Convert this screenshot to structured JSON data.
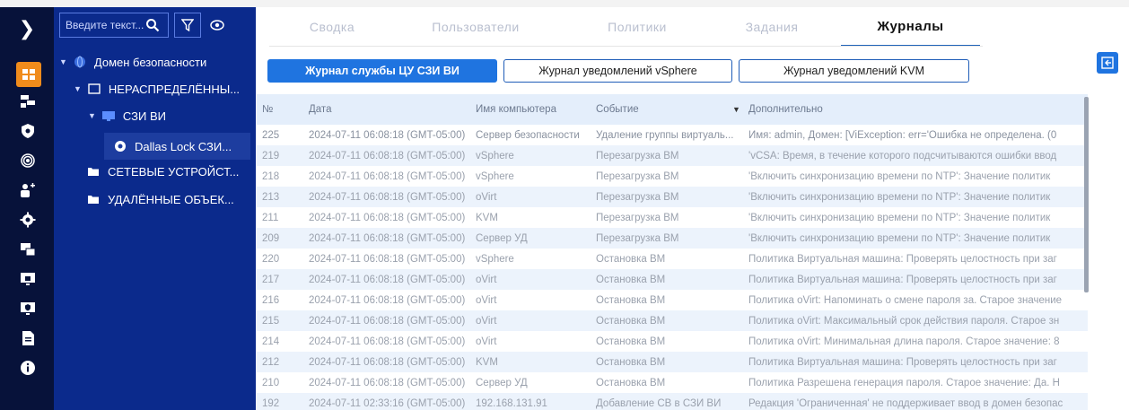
{
  "rail": {
    "toggle_glyph": "❯",
    "icons": [
      "grid-icon",
      "servers-icon",
      "shield-icon",
      "fingerprint-icon",
      "users-add-icon",
      "gear-icon",
      "devices-icon",
      "monitor-lock-icon",
      "monitor-shield-icon",
      "document-icon",
      "info-icon"
    ],
    "active_icon": "grid-icon",
    "accent_color": "#f08c1c"
  },
  "tree": {
    "search_placeholder": "Введите текст...",
    "nodes": [
      {
        "label": "Домен безопасности",
        "level": 0
      },
      {
        "label": "НЕРАСПРЕДЕЛЁННЫ...",
        "level": 1
      },
      {
        "label": "СЗИ ВИ",
        "level": 2
      },
      {
        "label": "Dallas Lock СЗИ...",
        "level": 3
      },
      {
        "label": "СЕТЕВЫЕ УСТРОЙСТ...",
        "level": 1
      },
      {
        "label": "УДАЛЁННЫЕ ОБЪЕК...",
        "level": 1
      }
    ]
  },
  "tabs": [
    {
      "label": "Сводка"
    },
    {
      "label": "Пользователи"
    },
    {
      "label": "Политики"
    },
    {
      "label": "Задания"
    },
    {
      "label": "Журналы",
      "active": true
    }
  ],
  "subtabs": [
    {
      "label": "Журнал службы ЦУ СЗИ ВИ",
      "active": true
    },
    {
      "label": "Журнал уведомлений vSphere"
    },
    {
      "label": "Журнал уведомлений KVM"
    }
  ],
  "table": {
    "columns": [
      "№",
      "Дата",
      "Имя компьютера",
      "Событие",
      "Дополнительно"
    ],
    "sorted_column": "Событие",
    "rows": [
      {
        "num": "225",
        "date": "2024-07-11 06:08:18 (GMT-05:00)",
        "computer": "Сервер безопасности",
        "event": "Удаление группы виртуаль...",
        "extra": "Имя: admin, Домен: [ViException: err='Ошибка не определена. (0"
      },
      {
        "num": "219",
        "date": "2024-07-11 06:08:18 (GMT-05:00)",
        "computer": "vSphere",
        "event": "Перезагрузка ВМ",
        "extra": "'vCSA: Время, в течение которого подсчитываются ошибки ввод"
      },
      {
        "num": "218",
        "date": "2024-07-11 06:08:18 (GMT-05:00)",
        "computer": "vSphere",
        "event": "Перезагрузка ВМ",
        "extra": "'Включить синхронизацию времени по NTP': Значение политик"
      },
      {
        "num": "213",
        "date": "2024-07-11 06:08:18 (GMT-05:00)",
        "computer": "oVirt",
        "event": "Перезагрузка ВМ",
        "extra": "'Включить синхронизацию времени по NTP': Значение политик"
      },
      {
        "num": "211",
        "date": "2024-07-11 06:08:18 (GMT-05:00)",
        "computer": "KVM",
        "event": "Перезагрузка ВМ",
        "extra": "'Включить синхронизацию времени по NTP': Значение политик"
      },
      {
        "num": "209",
        "date": "2024-07-11 06:08:18 (GMT-05:00)",
        "computer": "Сервер УД",
        "event": "Перезагрузка ВМ",
        "extra": "'Включить синхронизацию времени по NTP': Значение политик"
      },
      {
        "num": "220",
        "date": "2024-07-11 06:08:18 (GMT-05:00)",
        "computer": "vSphere",
        "event": "Остановка ВМ",
        "extra": "Политика Виртуальная машина: Проверять целостность при заг"
      },
      {
        "num": "217",
        "date": "2024-07-11 06:08:18 (GMT-05:00)",
        "computer": "oVirt",
        "event": "Остановка ВМ",
        "extra": "Политика Виртуальная машина: Проверять целостность при заг"
      },
      {
        "num": "216",
        "date": "2024-07-11 06:08:18 (GMT-05:00)",
        "computer": "oVirt",
        "event": "Остановка ВМ",
        "extra": "Политика oVirt: Напоминать о смене пароля за. Старое значение"
      },
      {
        "num": "215",
        "date": "2024-07-11 06:08:18 (GMT-05:00)",
        "computer": "oVirt",
        "event": "Остановка ВМ",
        "extra": "Политика oVirt: Максимальный срок действия пароля. Старое зн"
      },
      {
        "num": "214",
        "date": "2024-07-11 06:08:18 (GMT-05:00)",
        "computer": "oVirt",
        "event": "Остановка ВМ",
        "extra": "Политика oVirt: Минимальная длина пароля. Старое значение: 8"
      },
      {
        "num": "212",
        "date": "2024-07-11 06:08:18 (GMT-05:00)",
        "computer": "KVM",
        "event": "Остановка ВМ",
        "extra": "Политика Виртуальная машина: Проверять целостность при заг"
      },
      {
        "num": "210",
        "date": "2024-07-11 06:08:18 (GMT-05:00)",
        "computer": "Сервер УД",
        "event": "Остановка ВМ",
        "extra": "Политика Разрешена генерация пароля. Старое значение: Да. Н"
      },
      {
        "num": "192",
        "date": "2024-07-11 02:33:16 (GMT-05:00)",
        "computer": "192.168.131.91",
        "event": "Добавление СВ в СЗИ ВИ",
        "extra": "Редакция 'Ограниченная' не поддерживает ввод в домен безопас"
      }
    ]
  },
  "colors": {
    "rail_bg": "#07123a",
    "tree_bg": "#0b2a8c",
    "accent_blue": "#1f74e0"
  }
}
